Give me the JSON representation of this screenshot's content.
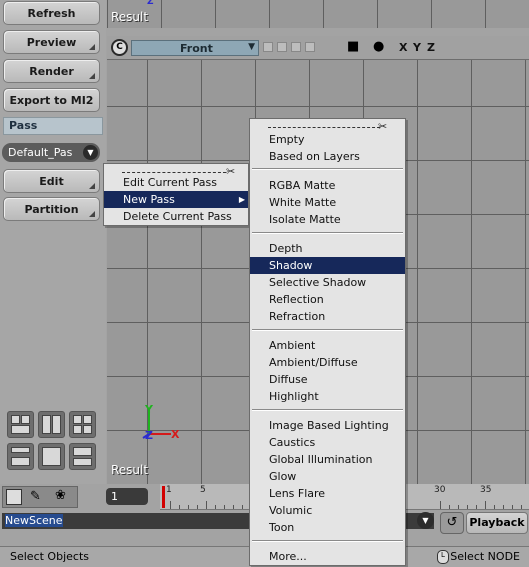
{
  "left_panel": {
    "buttons": [
      "Refresh",
      "Preview",
      "Render",
      "Export to MI2"
    ],
    "pass_label": "Pass",
    "pass_select_value": "Default_Pas",
    "edit_button": "Edit",
    "partition_button": "Partition"
  },
  "viewports": {
    "top_title": "Result",
    "main_title": "Result",
    "camera_select": "Front",
    "axis_labels": [
      "X",
      "Y",
      "Z"
    ],
    "gizmo_labels": {
      "x": "X",
      "y": "Y",
      "z": "Z"
    },
    "small_z": "Z"
  },
  "edit_menu": {
    "items": [
      "Edit Current Pass",
      "New Pass",
      "Delete Current Pass"
    ]
  },
  "new_pass_menu": {
    "groups": [
      [
        "Empty",
        "Based on Layers"
      ],
      [
        "RGBA Matte",
        "White Matte",
        "Isolate Matte"
      ],
      [
        "Depth",
        "Shadow",
        "Selective Shadow",
        "Reflection",
        "Refraction"
      ],
      [
        "Ambient",
        "Ambient/Diffuse",
        "Diffuse",
        "Highlight"
      ],
      [
        "Image Based Lighting",
        "Caustics",
        "Global Illumination",
        "Glow",
        "Lens Flare",
        "Volumic",
        "Toon"
      ],
      [
        "More..."
      ]
    ],
    "selected": "Shadow"
  },
  "timeline": {
    "frame_value": "1",
    "ruler_numbers": [
      "1",
      "5",
      "30",
      "35"
    ]
  },
  "scene": {
    "name": "NewScene",
    "playback_button": "Playback"
  },
  "status": {
    "left": "Select Objects",
    "mouse_hint": "L",
    "right": "Select NODE"
  },
  "colors": {
    "selection": "#16285a",
    "viewport_bg": "#999999",
    "grid": "#5f5f5f",
    "playhead": "#d20000"
  }
}
